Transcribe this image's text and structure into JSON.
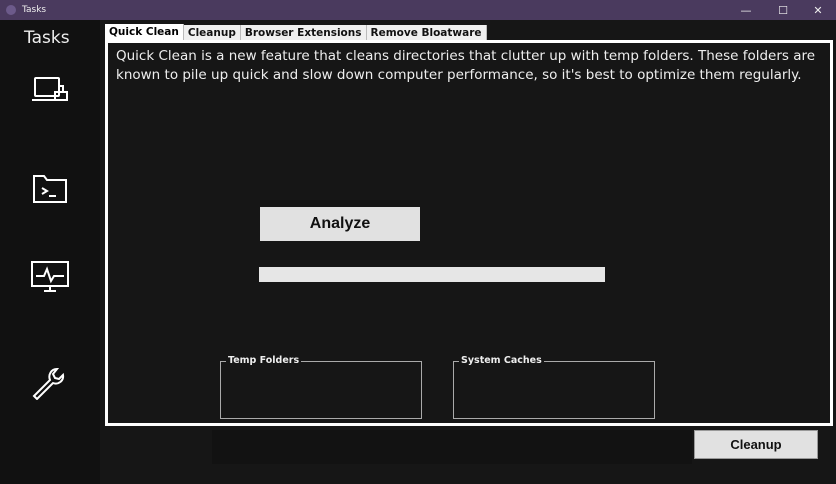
{
  "window": {
    "title": "Tasks",
    "minimize": "—",
    "maximize": "☐",
    "close": "✕"
  },
  "sidebar": {
    "heading": "Tasks",
    "items": [
      {
        "icon": "laptop-clean-icon"
      },
      {
        "icon": "terminal-folder-icon"
      },
      {
        "icon": "monitor-pulse-icon"
      },
      {
        "icon": "wrench-icon"
      }
    ]
  },
  "tabs": [
    "Quick Clean",
    "Cleanup",
    "Browser Extensions",
    "Remove Bloatware"
  ],
  "quick_clean": {
    "description": "Quick Clean is a new feature that cleans directories that clutter up with temp folders. These folders are known to pile up quick and slow down computer performance, so it's best to optimize them regularly.",
    "analyze_label": "Analyze",
    "progress": 0,
    "groups": [
      "Temp Folders",
      "System Caches"
    ]
  },
  "cleanup_label": "Cleanup"
}
